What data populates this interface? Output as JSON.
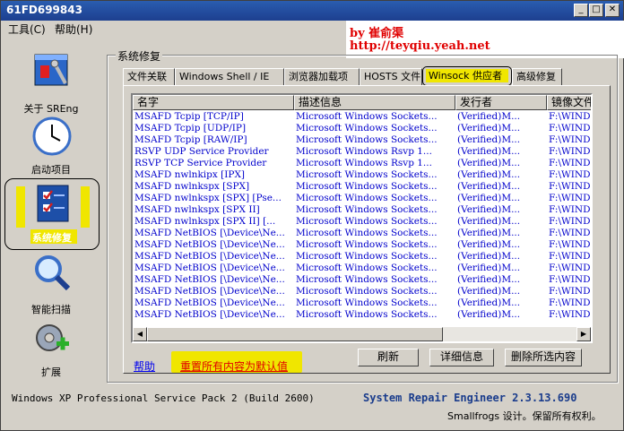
{
  "window": {
    "title": "61FD699843"
  },
  "menu": {
    "tools": "工具(C)",
    "help": "帮助(H)"
  },
  "banner": {
    "line1": "by 崔俞渠",
    "line2": "http://teyqiu.yeah.net"
  },
  "sidebar": {
    "items": [
      {
        "label": "关于 SREng",
        "icon": "about-icon"
      },
      {
        "label": "启动项目",
        "icon": "clock-icon"
      },
      {
        "label": "系统修复",
        "icon": "checklist-icon"
      },
      {
        "label": "智能扫描",
        "icon": "magnifier-icon"
      },
      {
        "label": "扩展",
        "icon": "gear-plus-icon"
      }
    ]
  },
  "group": {
    "title": "系统修复"
  },
  "tabs": [
    "文件关联",
    "Windows Shell / IE",
    "浏览器加载项",
    "HOSTS 文件",
    "Winsock 供应者",
    "高级修复"
  ],
  "columns": [
    "名字",
    "描述信息",
    "发行者",
    "镜像文件"
  ],
  "rows": [
    [
      "MSAFD Tcpip [TCP/IP]",
      "Microsoft Windows Sockets...",
      "(Verified)M...",
      "F:\\WIND"
    ],
    [
      "MSAFD Tcpip [UDP/IP]",
      "Microsoft Windows Sockets...",
      "(Verified)M...",
      "F:\\WIND"
    ],
    [
      "MSAFD Tcpip [RAW/IP]",
      "Microsoft Windows Sockets...",
      "(Verified)M...",
      "F:\\WIND"
    ],
    [
      "RSVP UDP Service Provider",
      "Microsoft Windows Rsvp 1...",
      "(Verified)M...",
      "F:\\WIND"
    ],
    [
      "RSVP TCP Service Provider",
      "Microsoft Windows Rsvp 1...",
      "(Verified)M...",
      "F:\\WIND"
    ],
    [
      "MSAFD nwlnkipx [IPX]",
      "Microsoft Windows Sockets...",
      "(Verified)M...",
      "F:\\WIND"
    ],
    [
      "MSAFD nwlnkspx [SPX]",
      "Microsoft Windows Sockets...",
      "(Verified)M...",
      "F:\\WIND"
    ],
    [
      "MSAFD nwlnkspx [SPX] [Pse...",
      "Microsoft Windows Sockets...",
      "(Verified)M...",
      "F:\\WIND"
    ],
    [
      "MSAFD nwlnkspx [SPX II]",
      "Microsoft Windows Sockets...",
      "(Verified)M...",
      "F:\\WIND"
    ],
    [
      "MSAFD nwlnkspx [SPX II] [...",
      "Microsoft Windows Sockets...",
      "(Verified)M...",
      "F:\\WIND"
    ],
    [
      "MSAFD NetBIOS [\\Device\\Ne...",
      "Microsoft Windows Sockets...",
      "(Verified)M...",
      "F:\\WIND"
    ],
    [
      "MSAFD NetBIOS [\\Device\\Ne...",
      "Microsoft Windows Sockets...",
      "(Verified)M...",
      "F:\\WIND"
    ],
    [
      "MSAFD NetBIOS [\\Device\\Ne...",
      "Microsoft Windows Sockets...",
      "(Verified)M...",
      "F:\\WIND"
    ],
    [
      "MSAFD NetBIOS [\\Device\\Ne...",
      "Microsoft Windows Sockets...",
      "(Verified)M...",
      "F:\\WIND"
    ],
    [
      "MSAFD NetBIOS [\\Device\\Ne...",
      "Microsoft Windows Sockets...",
      "(Verified)M...",
      "F:\\WIND"
    ],
    [
      "MSAFD NetBIOS [\\Device\\Ne...",
      "Microsoft Windows Sockets...",
      "(Verified)M...",
      "F:\\WIND"
    ],
    [
      "MSAFD NetBIOS [\\Device\\Ne...",
      "Microsoft Windows Sockets...",
      "(Verified)M...",
      "F:\\WIND"
    ],
    [
      "MSAFD NetBIOS [\\Device\\Ne...",
      "Microsoft Windows Sockets...",
      "(Verified)M...",
      "F:\\WIND"
    ]
  ],
  "actions": {
    "help": "帮助",
    "reset": "重置所有内容为默认值",
    "refresh": "刷新",
    "details": "详细信息",
    "delete_selected": "删除所选内容"
  },
  "status": {
    "os": "Windows XP Professional Service Pack 2 (Build 2600)",
    "product": "System Repair Engineer 2.3.13.690",
    "copyright": "Smallfrogs 设计。保留所有权利。"
  },
  "colors": {
    "highlight": "#f0e600",
    "row_text": "#0000cc",
    "banner_text": "#e00000"
  }
}
